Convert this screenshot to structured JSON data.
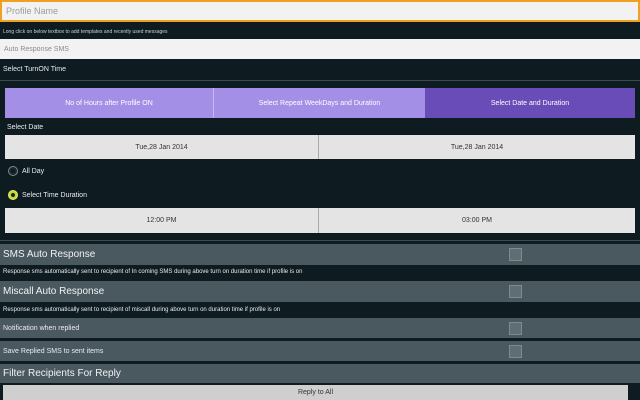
{
  "profile": {
    "name_placeholder": "Profile Name"
  },
  "hint": "Long click on below textbox to add templates and recently used messages",
  "auto_response": {
    "placeholder": "Auto Response SMS"
  },
  "turn_on_label": "Select TurnON Time",
  "tabs": [
    {
      "label": "No of Hours after Profile ON"
    },
    {
      "label": "Select Repeat WeekDays and Duration"
    },
    {
      "label": "Select Date and Duration"
    }
  ],
  "select_date_label": "Select Date",
  "dates": {
    "start": "Tue,28 Jan 2014",
    "end": "Tue,28 Jan 2014"
  },
  "radios": {
    "all_day": "All Day",
    "time_duration": "Select Time Duration"
  },
  "times": {
    "start": "12:00 PM",
    "end": "03:00 PM"
  },
  "sms_section": {
    "title": "SMS Auto Response",
    "desc": "Response sms automatically sent to recipient of In coming SMS during above turn on duration time if profile is on"
  },
  "miscall_section": {
    "title": "Miscall Auto Response",
    "desc": "Response sms automatically sent to recipient of miscall during above turn on duration time if profile is on"
  },
  "options": {
    "notify": "Notification when replied",
    "save": "Save Replied SMS to sent items"
  },
  "filter": {
    "title": "Filter Recipients For Reply",
    "reply_all": "Reply to All"
  },
  "colors": {
    "accent": "#f0a020",
    "tab_light": "#a48fe6",
    "tab_dark": "#6a4cb8"
  }
}
